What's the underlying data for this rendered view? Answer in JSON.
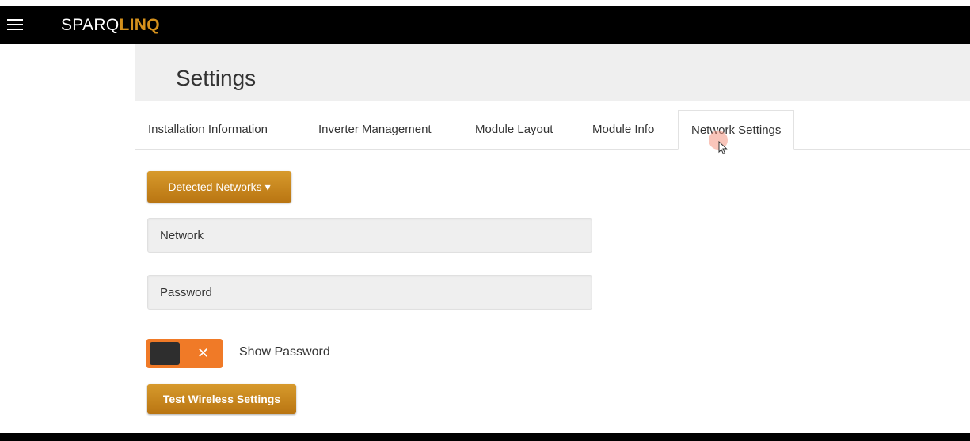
{
  "app": {
    "brand_prefix": "SPARQ",
    "brand_accent": "LINQ",
    "brand_accent_color": "#d4901c"
  },
  "page": {
    "title": "Settings"
  },
  "tabs": [
    {
      "label": "Installation Information"
    },
    {
      "label": "Inverter Management"
    },
    {
      "label": "Module Layout"
    },
    {
      "label": "Module Info"
    },
    {
      "label": "Network Settings",
      "active": true
    }
  ],
  "form": {
    "detected_networks_label": "Detected Networks ▾",
    "network_placeholder": "Network",
    "network_value": "",
    "password_placeholder": "Password",
    "password_value": "",
    "show_password_label": "Show Password",
    "show_password_toggle_symbol": "✕",
    "show_password_on": false,
    "test_button_label": "Test Wireless Settings"
  },
  "icons": {
    "menu": "hamburger-icon",
    "cursor": "mouse-pointer-icon"
  }
}
